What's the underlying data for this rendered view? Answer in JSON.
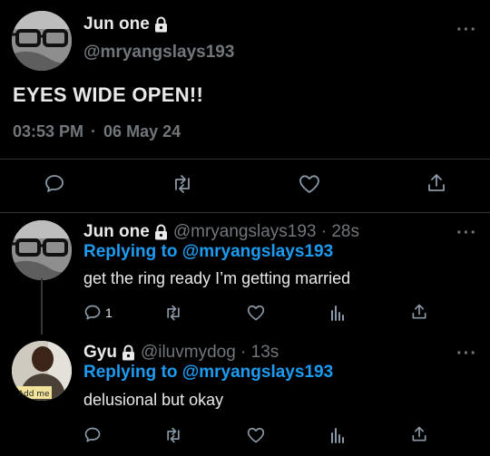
{
  "main_tweet": {
    "display_name": "Jun one",
    "handle": "@mryangslays193",
    "text": "EYES WIDE OPEN!!",
    "time": "03:53 PM",
    "separator": "·",
    "date": "06 May 24"
  },
  "replies": [
    {
      "display_name": "Jun one",
      "handle_time": "@mryangslays193 · 28s",
      "replying_to_prefix": "Replying to",
      "replying_to_handle": "@mryangslays193",
      "text": "get the ring ready I’m getting married",
      "reply_count": "1"
    },
    {
      "display_name": "Gyu",
      "handle_time": "@iluvmydog · 13s",
      "replying_to_prefix": "Replying to",
      "replying_to_handle": "@mryangslays193",
      "text": "delusional but okay",
      "sign_text": "Add me"
    }
  ],
  "more_label": "···",
  "colors": {
    "background": "#000000",
    "accent": "#1d9bf0",
    "muted": "#71767b",
    "divider": "#2f3336"
  }
}
